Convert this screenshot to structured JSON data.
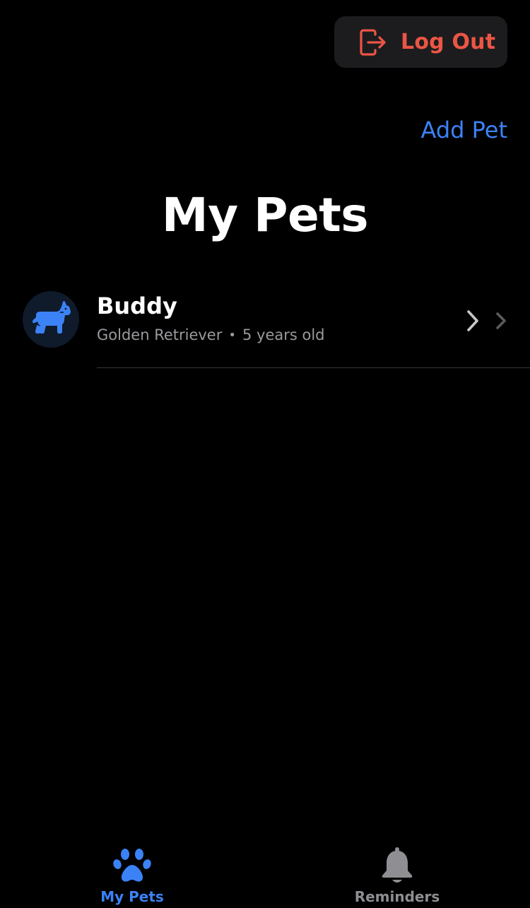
{
  "header": {
    "logout_label": "Log Out",
    "add_pet_label": "Add Pet"
  },
  "page": {
    "title": "My Pets"
  },
  "pets": [
    {
      "name": "Buddy",
      "breed": "Golden Retriever",
      "separator": "•",
      "age": "5 years old",
      "avatar_icon": "dog-icon"
    }
  ],
  "tabbar": {
    "tabs": [
      {
        "label": "My Pets",
        "icon": "paw-icon",
        "selected": true
      },
      {
        "label": "Reminders",
        "icon": "bell-icon",
        "selected": false
      }
    ]
  },
  "colors": {
    "accent": "#3b82f6",
    "destructive": "#eb5545",
    "background": "#000000",
    "secondary_text": "#9a9a9f",
    "inactive_tab": "#8e8e93"
  }
}
